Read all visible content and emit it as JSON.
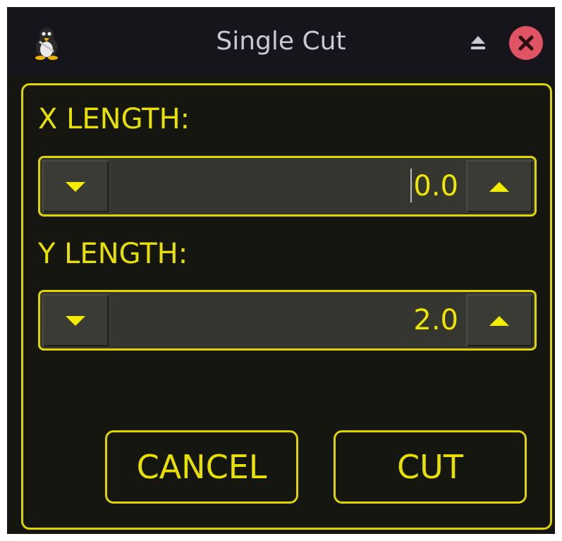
{
  "window": {
    "title": "Single Cut"
  },
  "titlebar_icons": {
    "app": "penguin-icon",
    "shade": "eject-icon",
    "close": "close-icon"
  },
  "fields": {
    "x": {
      "label": "X LENGTH:",
      "value": "0.0"
    },
    "y": {
      "label": "Y LENGTH:",
      "value": "2.0"
    }
  },
  "buttons": {
    "cancel": "CANCEL",
    "cut": "CUT"
  },
  "colors": {
    "accent": "#e7e000",
    "background": "#161610",
    "titlebar": "#15151b",
    "close": "#e05364"
  }
}
